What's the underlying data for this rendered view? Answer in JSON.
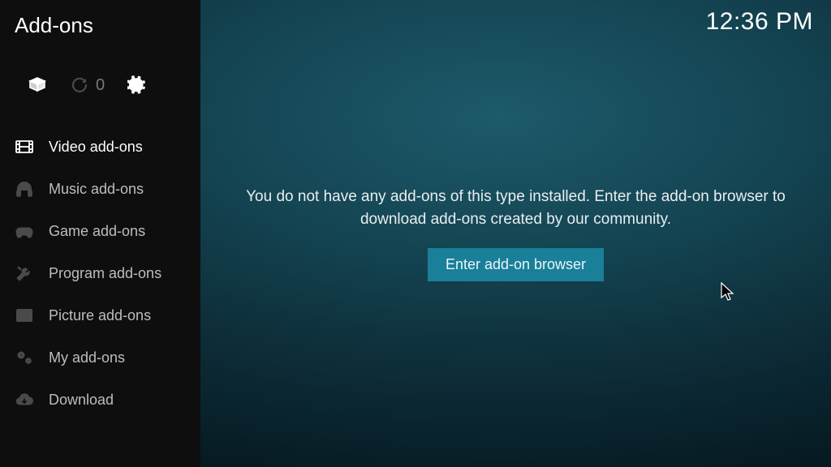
{
  "header": {
    "title": "Add-ons"
  },
  "clock": "12:36 PM",
  "toolbar": {
    "update_count": "0"
  },
  "sidebar": {
    "items": [
      {
        "label": "Video add-ons"
      },
      {
        "label": "Music add-ons"
      },
      {
        "label": "Game add-ons"
      },
      {
        "label": "Program add-ons"
      },
      {
        "label": "Picture add-ons"
      },
      {
        "label": "My add-ons"
      },
      {
        "label": "Download"
      }
    ]
  },
  "main": {
    "empty_message": "You do not have any add-ons of this type installed. Enter the add-on browser to download add-ons created by our community.",
    "enter_button": "Enter add-on browser"
  },
  "colors": {
    "accent": "#1a7f99"
  }
}
